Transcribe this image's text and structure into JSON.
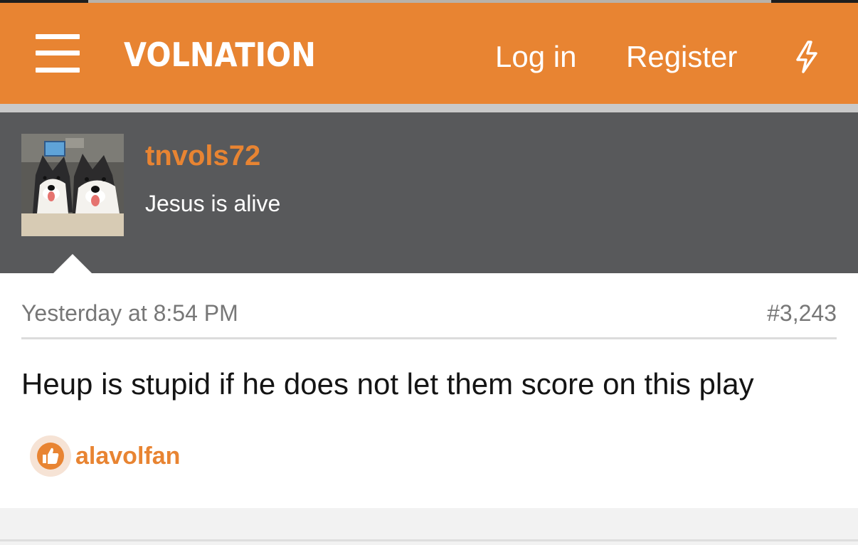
{
  "header": {
    "logo_text": "VOLNATION",
    "login_label": "Log in",
    "register_label": "Register",
    "menu_icon": "hamburger-menu-icon",
    "whats_new_icon": "lightning-bolt-icon",
    "background_color": "#e88432"
  },
  "post": {
    "author": {
      "username": "tnvols72",
      "user_title": "Jesus is alive",
      "avatar": "avatar-two-husky-dogs"
    },
    "date": "Yesterday at 8:54 PM",
    "number": "#3,243",
    "body": "Heup is stupid if he does not let them score on this play",
    "likes": {
      "icon": "thumbs-up-icon",
      "names": "alavolfan"
    }
  },
  "colors": {
    "accent": "#e88432",
    "user_panel": "#58595b",
    "meta_text": "#777777"
  }
}
